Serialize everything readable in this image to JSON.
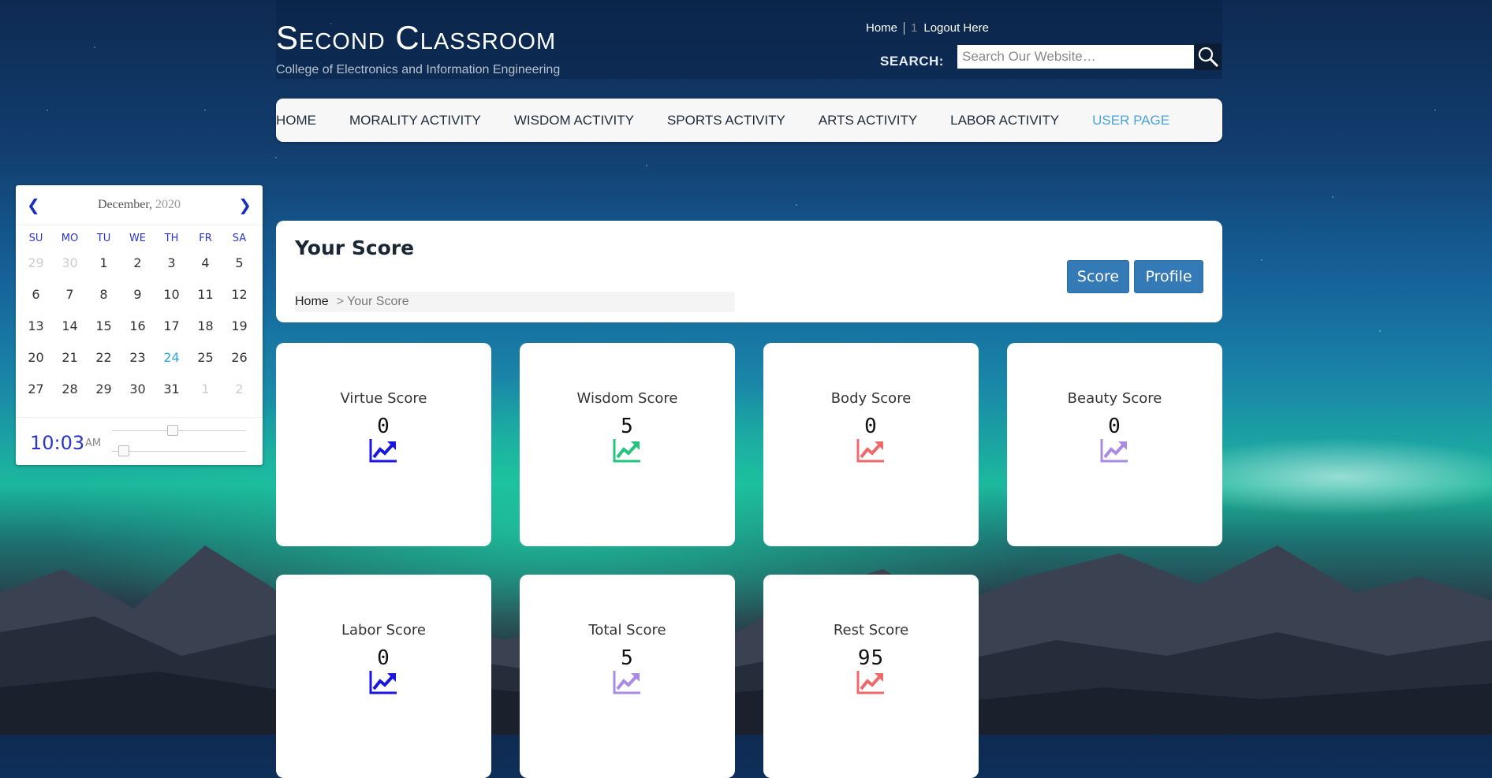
{
  "header": {
    "title": "Second Classroom",
    "subtitle": "College of Electronics and Information Engineering",
    "links": {
      "home": "Home",
      "sep": "1",
      "logout": "Logout Here"
    },
    "search_label": "SEARCH:",
    "search_placeholder": "Search Our Website…"
  },
  "nav": [
    {
      "label": "HOME"
    },
    {
      "label": "MORALITY ACTIVITY"
    },
    {
      "label": "WISDOM ACTIVITY"
    },
    {
      "label": "SPORTS ACTIVITY"
    },
    {
      "label": "ARTS ACTIVITY"
    },
    {
      "label": "LABOR ACTIVITY"
    },
    {
      "label": "USER PAGE",
      "active": true
    }
  ],
  "calendar": {
    "month": "December,",
    "year": "2020",
    "weekdays": [
      "SU",
      "MO",
      "TU",
      "WE",
      "TH",
      "FR",
      "SA"
    ],
    "days": [
      "29",
      "30",
      "1",
      "2",
      "3",
      "4",
      "5",
      "6",
      "7",
      "8",
      "9",
      "10",
      "11",
      "12",
      "13",
      "14",
      "15",
      "16",
      "17",
      "18",
      "19",
      "20",
      "21",
      "22",
      "23",
      "24",
      "25",
      "26",
      "27",
      "28",
      "29",
      "30",
      "31",
      "1",
      "2"
    ],
    "muted_indices": [
      0,
      1,
      33,
      34
    ],
    "today_index": 25,
    "time": "10:03",
    "ampm": "AM",
    "hour_slider": 0.45,
    "minute_slider": 0.05
  },
  "panel": {
    "title": "Your Score",
    "breadcrumb_home": "Home",
    "breadcrumb_arrow": ">",
    "breadcrumb_current": "Your Score",
    "button_score": "Score",
    "button_profile": "Profile"
  },
  "cards": [
    {
      "label": "Virtue Score",
      "value": "0",
      "icon": "trend-up-icon",
      "color": "#1a16e0"
    },
    {
      "label": "Wisdom Score",
      "value": "5",
      "icon": "trend-up-icon",
      "color": "#23c47e"
    },
    {
      "label": "Body Score",
      "value": "0",
      "icon": "trend-up-icon",
      "color": "#ee6a6a"
    },
    {
      "label": "Beauty Score",
      "value": "0",
      "icon": "trend-up-icon",
      "color": "#a98be6"
    },
    {
      "label": "Labor Score",
      "value": "0",
      "icon": "trend-up-icon",
      "color": "#1a16e0"
    },
    {
      "label": "Total Score",
      "value": "5",
      "icon": "trend-up-icon",
      "color": "#a98be6"
    },
    {
      "label": "Rest Score",
      "value": "95",
      "icon": "trend-up-icon",
      "color": "#ee6a6a"
    }
  ],
  "colors": {
    "accent": "#337ab7",
    "nav_active": "#4aa3d8",
    "calendar_accent": "#2a35c9"
  }
}
